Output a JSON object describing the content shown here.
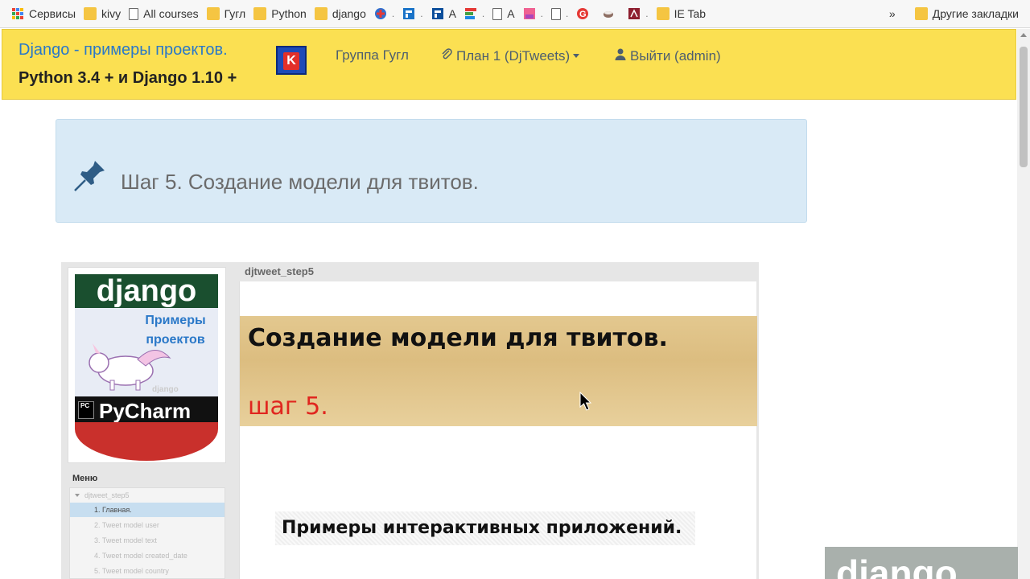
{
  "bookmarks": {
    "items": [
      {
        "label": "Сервисы",
        "icon": "apps-grid-icon"
      },
      {
        "label": "kivy",
        "icon": "folder-icon"
      },
      {
        "label": "All courses",
        "icon": "page-icon"
      },
      {
        "label": "Гугл",
        "icon": "folder-icon"
      },
      {
        "label": "Python",
        "icon": "folder-icon"
      },
      {
        "label": "django",
        "icon": "folder-icon"
      }
    ],
    "compact_a1": "A",
    "compact_a2": "A",
    "ie_tab": "IE Tab",
    "more_glyph": "»",
    "other": "Другие закладки"
  },
  "navbar": {
    "brand_line1": "Django - примеры проектов.",
    "brand_line2": "Python 3.4 + и Django 1.10 +",
    "links": [
      {
        "label": "Группа Гугл"
      },
      {
        "label": "План 1 (DjTweets)"
      },
      {
        "label": "Выйти (admin)"
      }
    ]
  },
  "step": {
    "title": "Шаг 5. Создание модели для твитов."
  },
  "embed": {
    "frame_title": "djtweet_step5",
    "cover": {
      "top": "django",
      "mid": "Примеры проектов",
      "small": "django",
      "bottom": "PyCharm",
      "badge": "PC"
    },
    "menu_title": "Меню",
    "menu_items": [
      "djtweet_step5",
      "1. Главная.",
      "2. Tweet model user",
      "3. Tweet model text",
      "4. Tweet model created_date",
      "5. Tweet model country"
    ],
    "banner_title": "Создание модели для твитов.",
    "banner_sub": "шаг 5.",
    "promo": "Примеры интерактивных приложений."
  },
  "corner": {
    "text": "django"
  },
  "colors": {
    "navbar_bg": "#fbe052",
    "brand_link": "#2a78c8",
    "panel_bg": "#d9eaf6",
    "accent_red": "#e0261f"
  }
}
